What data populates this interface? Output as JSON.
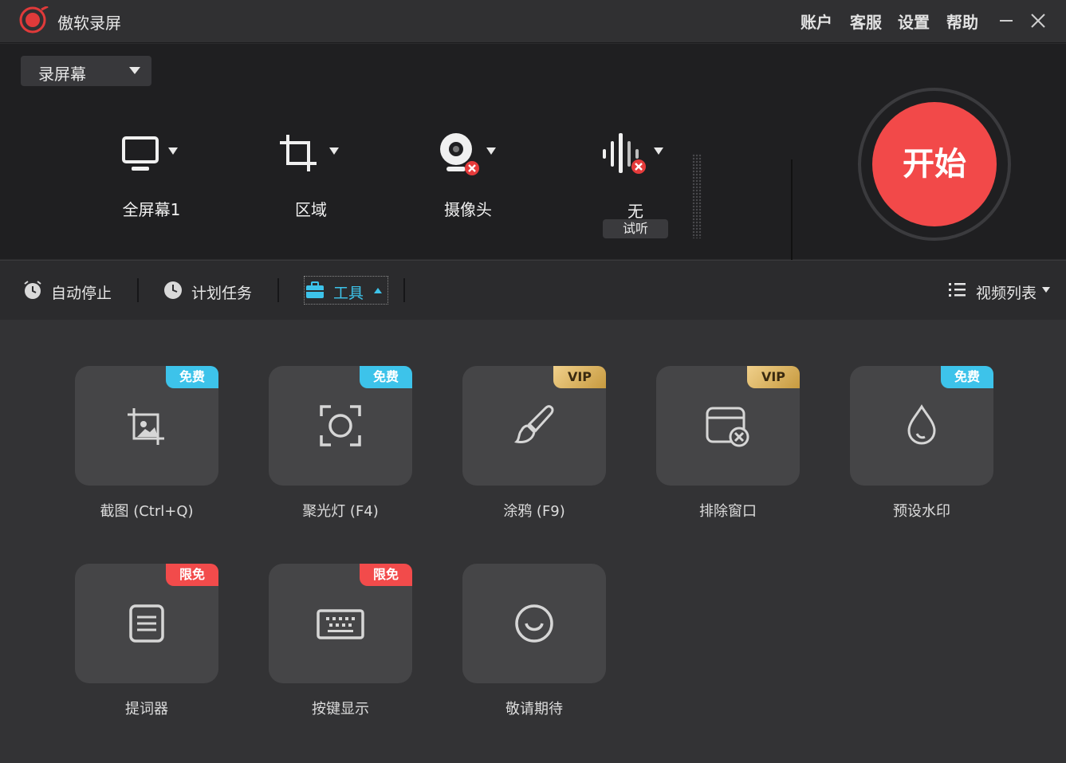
{
  "app": {
    "title": "傲软录屏"
  },
  "menu": {
    "account": "账户",
    "service": "客服",
    "settings": "设置",
    "help": "帮助"
  },
  "record": {
    "mode": "录屏幕",
    "screen_label": "全屏幕1",
    "region_label": "区域",
    "camera_label": "摄像头",
    "audio_listen": "试听",
    "audio_label": "无",
    "start_label": "开始"
  },
  "toolbar": {
    "auto_stop": "自动停止",
    "schedule": "计划任务",
    "tools": "工具",
    "video_list": "视频列表"
  },
  "tools": [
    {
      "label": "截图 (Ctrl+Q)",
      "badge": "免费",
      "badge_type": "free",
      "icon": "screenshot-icon"
    },
    {
      "label": "聚光灯 (F4)",
      "badge": "免费",
      "badge_type": "free",
      "icon": "spotlight-icon"
    },
    {
      "label": "涂鸦 (F9)",
      "badge": "VIP",
      "badge_type": "vip",
      "icon": "brush-icon"
    },
    {
      "label": "排除窗口",
      "badge": "VIP",
      "badge_type": "vip",
      "icon": "exclude-window-icon"
    },
    {
      "label": "预设水印",
      "badge": "免费",
      "badge_type": "free",
      "icon": "watermark-icon"
    },
    {
      "label": "提词器",
      "badge": "限免",
      "badge_type": "limit",
      "icon": "teleprompter-icon"
    },
    {
      "label": "按键显示",
      "badge": "限免",
      "badge_type": "limit",
      "icon": "keyboard-icon"
    },
    {
      "label": "敬请期待",
      "badge": "",
      "badge_type": "",
      "icon": "coming-soon-icon"
    }
  ],
  "colors": {
    "accent": "#f24949",
    "free": "#3dc3ea",
    "active_tab": "#3dc3ea"
  }
}
